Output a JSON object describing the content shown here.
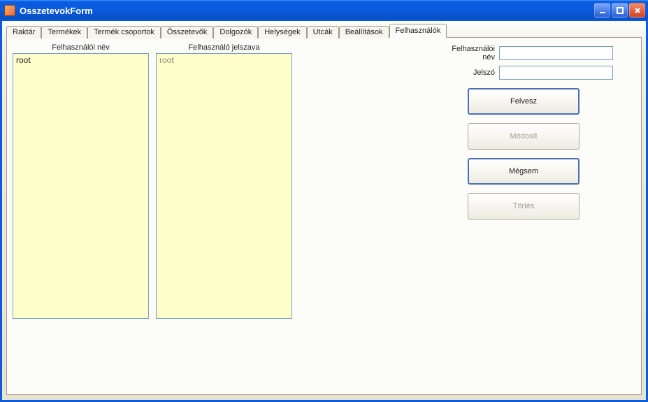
{
  "window": {
    "title": "OsszetevokForm"
  },
  "tabs": [
    {
      "label": "Raktár",
      "active": false
    },
    {
      "label": "Termékek",
      "active": false
    },
    {
      "label": "Termék csoportok",
      "active": false
    },
    {
      "label": "Összetevők",
      "active": false
    },
    {
      "label": "Dolgozók",
      "active": false
    },
    {
      "label": "Helységek",
      "active": false
    },
    {
      "label": "Utcák",
      "active": false
    },
    {
      "label": "Beállítások",
      "active": false
    },
    {
      "label": "Felhasználók",
      "active": true
    }
  ],
  "columns": {
    "username_header": "Felhasználói név",
    "password_header": "Felhasználó jelszava",
    "username_items": [
      "root"
    ],
    "password_items": [
      "root"
    ]
  },
  "form": {
    "username_label": "Felhasználói név",
    "password_label": "Jelszó",
    "username_value": "",
    "password_value": ""
  },
  "buttons": {
    "add": "Felvesz",
    "modify": "Módosít",
    "cancel": "Mégsem",
    "delete": "Törlés"
  }
}
